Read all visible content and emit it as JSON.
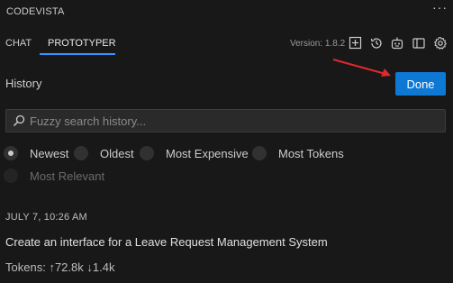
{
  "app": {
    "title": "CODEVISTA",
    "more_label": "···"
  },
  "tabs": [
    {
      "label": "CHAT",
      "active": false
    },
    {
      "label": "PROTOTYPER",
      "active": true
    }
  ],
  "toolbar": {
    "version": "Version: 1.8.2",
    "icons": [
      "new-item-icon",
      "history-icon",
      "robot-icon",
      "panel-icon",
      "gear-icon"
    ]
  },
  "history": {
    "title": "History",
    "done_label": "Done",
    "search_placeholder": "Fuzzy search history...",
    "search_value": "",
    "sort_options": [
      {
        "label": "Newest",
        "selected": true,
        "disabled": false
      },
      {
        "label": "Oldest",
        "selected": false,
        "disabled": false
      },
      {
        "label": "Most Expensive",
        "selected": false,
        "disabled": false
      },
      {
        "label": "Most Tokens",
        "selected": false,
        "disabled": false
      },
      {
        "label": "Most Relevant",
        "selected": false,
        "disabled": true
      }
    ],
    "entries": [
      {
        "date": "JULY 7, 10:26 AM",
        "title": "Create an interface for a Leave Request Management System",
        "tokens_label": "Tokens:",
        "tokens_up": "72.8k",
        "tokens_down": "1.4k"
      }
    ]
  },
  "colors": {
    "background": "#181818",
    "accent": "#0e78d5",
    "tab_underline": "#3794ff",
    "annotation_arrow": "#e0282e"
  }
}
